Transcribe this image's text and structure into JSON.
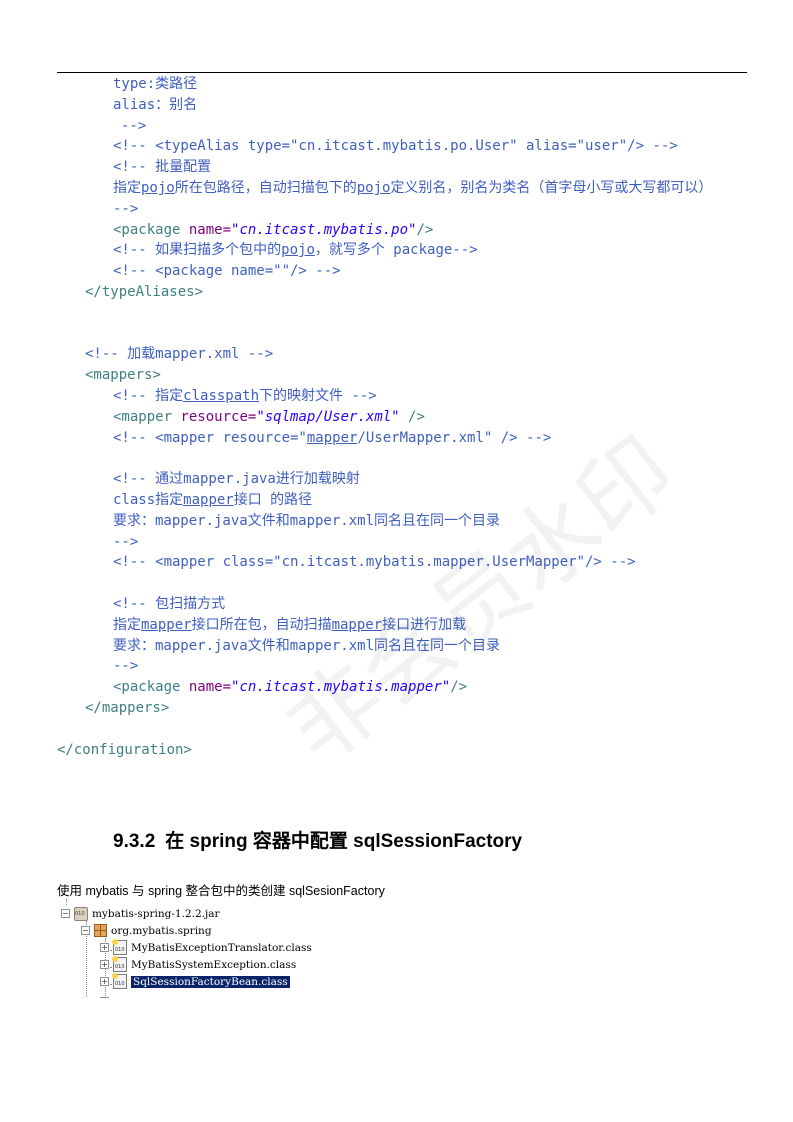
{
  "code": {
    "l1": "type:类路径",
    "l2": "alias：别名",
    "l3": "-->",
    "l4": "<!-- <typeAlias type=\"cn.itcast.mybatis.po.User\" alias=\"user\"/> -->",
    "l5": "<!-- 批量配置",
    "l6": {
      "a": "指定",
      "u1": "pojo",
      "b": "所在包路径，自动扫描包下的",
      "u2": "pojo",
      "c": "定义别名，别名为类名（首字母小写或大写都可以）"
    },
    "l7": "-->",
    "l8": {
      "tag_open": "<package",
      "attr": "name=",
      "val": "\"cn.itcast.mybatis.po\"",
      "tag_close": "/>"
    },
    "l9": {
      "a": "<!-- 如果扫描多个包中的",
      "u": "pojo",
      "b": "，就写多个 package-->"
    },
    "l10": "<!-- <package name=\"\"/> -->",
    "l11": "</typeAliases>",
    "l12": "<!-- 加载mapper.xml -->",
    "l13": "<mappers>",
    "l14": {
      "a": "<!-- 指定",
      "u": "classpath",
      "b": "下的映射文件 -->"
    },
    "l15": {
      "tag_open": "<mapper",
      "attr": "resource=",
      "val": "\"sqlmap/User.xml\"",
      "tag_close": "/>"
    },
    "l16": {
      "a": "<!-- <mapper resource=\"",
      "u": "mapper",
      "b": "/UserMapper.xml\" /> -->"
    },
    "l17": "<!-- 通过mapper.java进行加载映射",
    "l18": {
      "a": "class指定",
      "u": "mapper",
      "b": "接口 的路径"
    },
    "l19": "要求：mapper.java文件和mapper.xml同名且在同一个目录",
    "l20": "-->",
    "l21": "<!-- <mapper class=\"cn.itcast.mybatis.mapper.UserMapper\"/> -->",
    "l22": "<!-- 包扫描方式",
    "l23": {
      "a": "指定",
      "u1": "mapper",
      "b": "接口所在包，自动扫描",
      "u2": "mapper",
      "c": "接口进行加载"
    },
    "l24": "要求：mapper.java文件和mapper.xml同名且在同一个目录",
    "l25": "-->",
    "l26": {
      "tag_open": "<package",
      "attr": "name=",
      "val": "\"cn.itcast.mybatis.mapper\"",
      "tag_close": "/>"
    },
    "l27": "</mappers>",
    "l28": "</configuration>"
  },
  "heading": {
    "number": "9.3.2",
    "title": "在 spring 容器中配置 sqlSessionFactory"
  },
  "caption": "使用 mybatis 与 spring 整合包中的类创建 sqlSesionFactory",
  "tree": {
    "jar": "mybatis-spring-1.2.2.jar",
    "package": "org.mybatis.spring",
    "classes": [
      "MyBatisExceptionTranslator.class",
      "MyBatisSystemException.class",
      "SqlSessionFactoryBean.class"
    ],
    "expand_collapsed": "+",
    "expand_open": "−"
  },
  "watermark": "非会员水印",
  "colors": {
    "comment": "#3f5fbf",
    "tag": "#3f7f7f",
    "attr": "#7f007f",
    "value": "#2a00ff",
    "selection": "#0a246a"
  }
}
